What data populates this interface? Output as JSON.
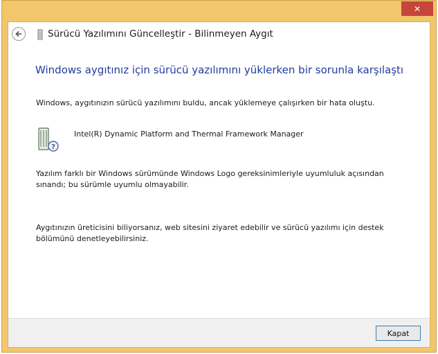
{
  "window": {
    "close_glyph": "✕",
    "title": "Sürücü Yazılımını Güncelleştir - Bilinmeyen Aygıt",
    "back_icon": "back-arrow-icon",
    "device_icon": "device-icon"
  },
  "content": {
    "heading": "Windows aygıtınız için sürücü yazılımını yüklerken bir sorunla karşılaştı",
    "message1": "Windows, aygıtınızın sürücü yazılımını buldu, ancak yüklemeye çalışırken bir hata oluştu.",
    "device_name": "Intel(R) Dynamic Platform and Thermal Framework Manager",
    "message2": "Yazılım farklı bir Windows sürümünde Windows Logo gereksinimleriyle uyumluluk açısından sınandı; bu sürümle uyumlu olmayabilir.",
    "message3": "Aygıtınızın üreticisini biliyorsanız, web sitesini ziyaret edebilir ve sürücü yazılımı için destek bölümünü denetleyebilirsiniz."
  },
  "footer": {
    "close_label": "Kapat"
  },
  "colors": {
    "frame": "#f2c66a",
    "heading": "#1f3c9c",
    "close_red": "#c7453a"
  }
}
